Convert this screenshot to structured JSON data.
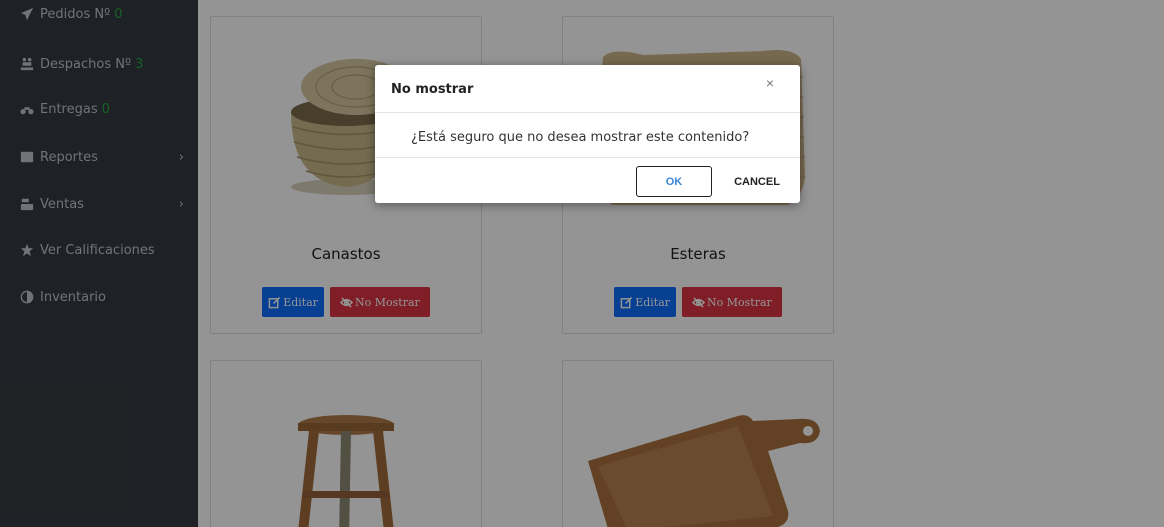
{
  "sidebar": {
    "items": [
      {
        "label": "Pedidos Nº",
        "count": "0",
        "icon": "paper-plane-icon"
      },
      {
        "label": "Despachos Nº",
        "count": "3",
        "icon": "people-carry-icon"
      },
      {
        "label": "Entregas",
        "count": "0",
        "icon": "motorcycle-icon"
      },
      {
        "label": "Reportes",
        "icon": "table-icon",
        "chevron": "›"
      },
      {
        "label": "Ventas",
        "icon": "cash-register-icon",
        "chevron": "›"
      },
      {
        "label": "Ver Calificaciones",
        "icon": "star-icon"
      },
      {
        "label": "Inventario",
        "icon": "adjust-icon"
      }
    ]
  },
  "products": [
    {
      "name": "Canastos",
      "edit_label": "Editar",
      "hide_label": "No Mostrar"
    },
    {
      "name": "Esteras",
      "edit_label": "Editar",
      "hide_label": "No Mostrar"
    }
  ],
  "modal": {
    "title": "No mostrar",
    "close": "×",
    "message": "¿Está seguro que no desea mostrar este contenido?",
    "ok_label": "OK",
    "cancel_label": "CANCEL"
  },
  "colors": {
    "sidebar_bg": "#343a40",
    "count_green": "#28a745",
    "edit_blue": "#0d6efd",
    "hide_red": "#dc3545"
  }
}
